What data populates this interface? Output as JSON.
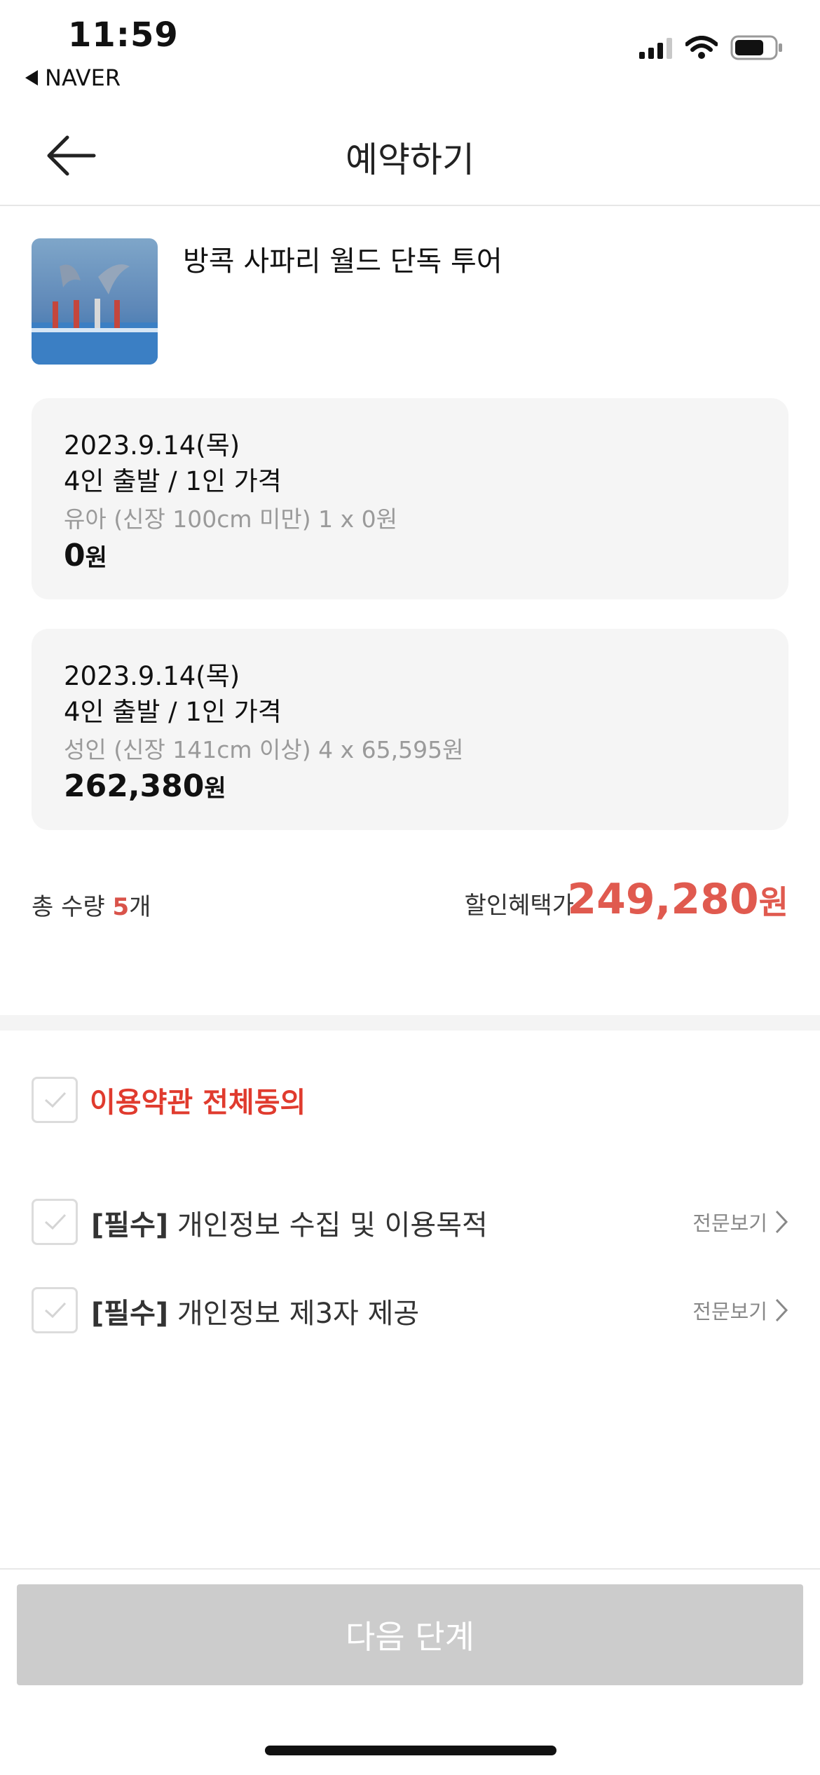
{
  "status_bar": {
    "time": "11:59",
    "back_app": "NAVER"
  },
  "header": {
    "title": "예약하기"
  },
  "product": {
    "name": "방콕 사파리 월드 단독 투어"
  },
  "options": [
    {
      "date": "2023.9.14(목)",
      "desc": "4인 출발 / 1인 가격",
      "detail": "유아 (신장 100cm 미만) 1 x 0원",
      "price": "0",
      "won": "원"
    },
    {
      "date": "2023.9.14(목)",
      "desc": "4인 출발 / 1인 가격",
      "detail": "성인 (신장 141cm 이상) 4 x 65,595원",
      "price": "262,380",
      "won": "원"
    }
  ],
  "summary": {
    "qty_label": "총 수량",
    "qty_count": "5",
    "qty_unit": "개",
    "discount_label": "할인혜택가",
    "discount_price": "249,280",
    "won": "원"
  },
  "agreements": {
    "all_label": "이용약관 전체동의",
    "items": [
      {
        "req": "[필수]",
        "label": "개인정보 수집 및 이용목적",
        "view": "전문보기"
      },
      {
        "req": "[필수]",
        "label": "개인정보 제3자 제공",
        "view": "전문보기"
      }
    ]
  },
  "footer": {
    "next_label": "다음 단계"
  },
  "colors": {
    "accent_red": "#e05a4f",
    "agree_red": "#e03b2e",
    "disabled_button": "#cccccc"
  }
}
